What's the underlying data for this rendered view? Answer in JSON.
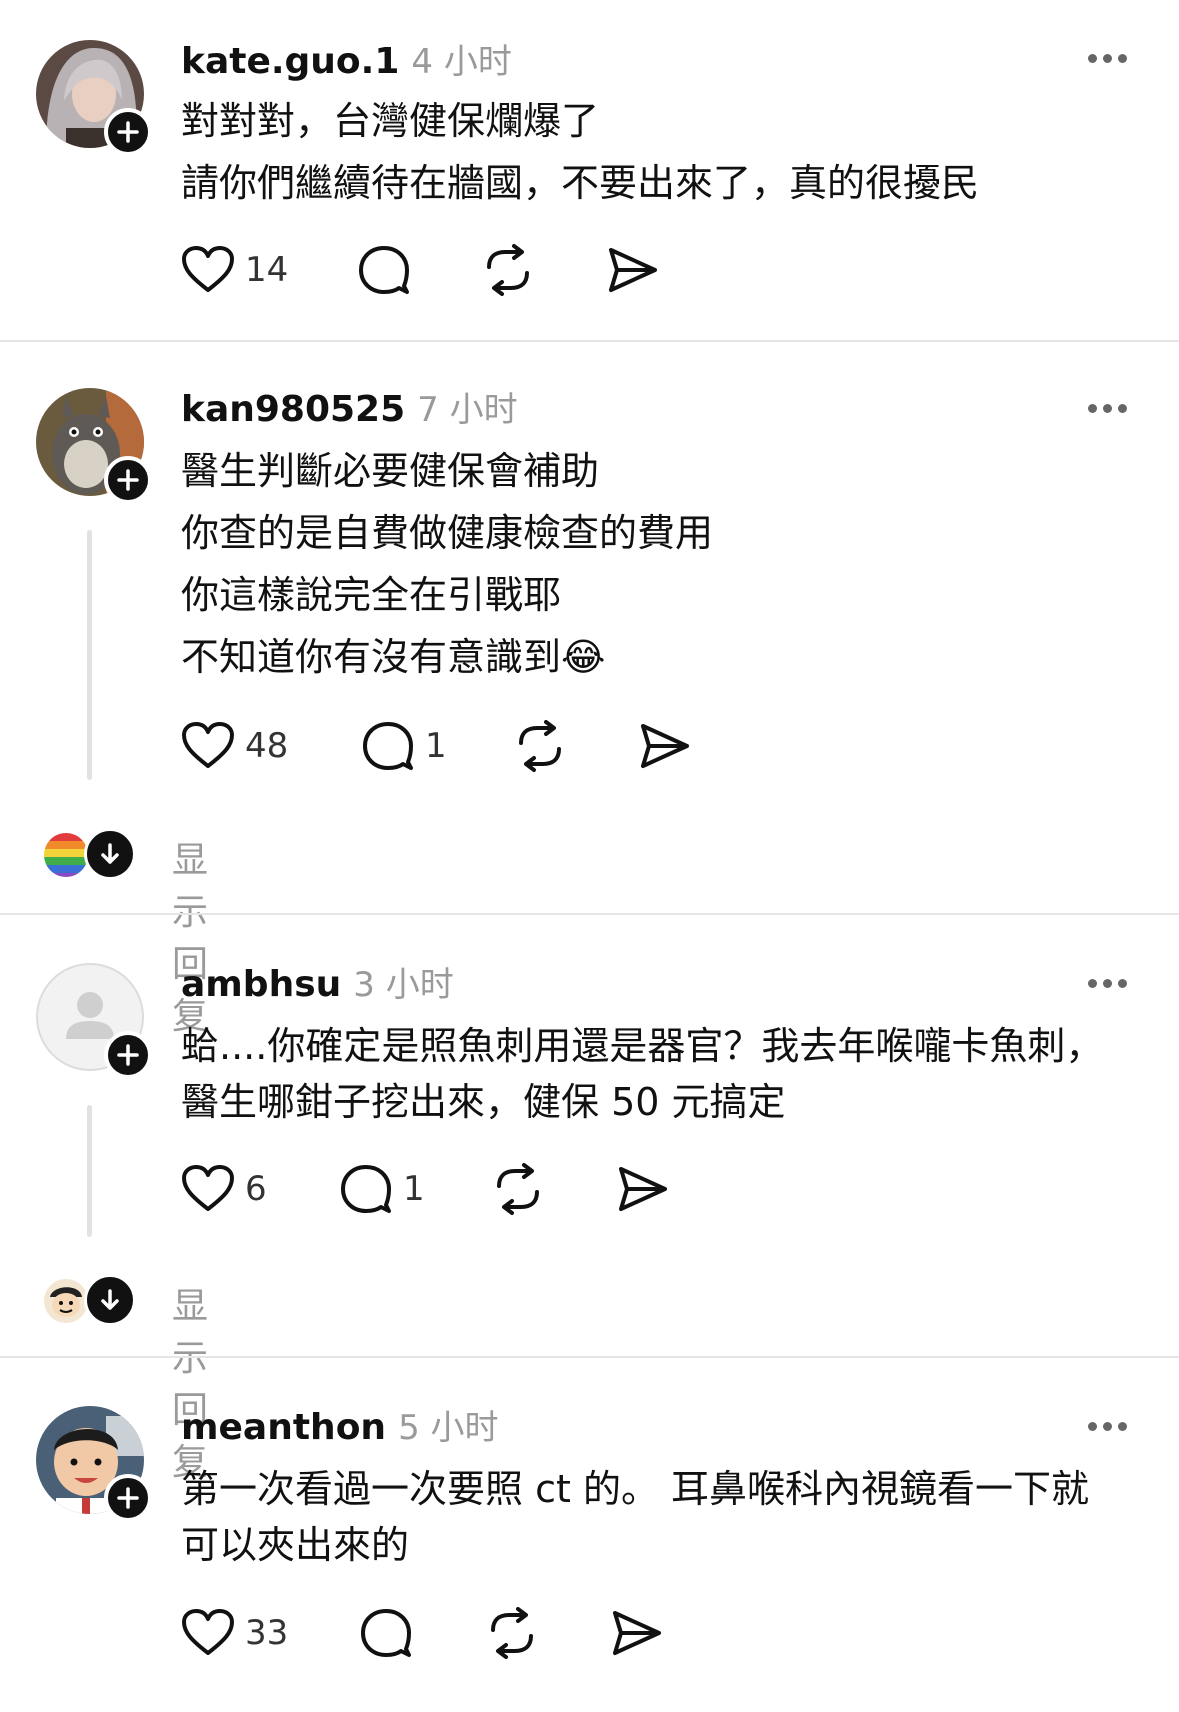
{
  "posts": [
    {
      "username": "kate.guo.1",
      "time": "4 小时",
      "lines": [
        "對對對，台灣健保爛爆了",
        "請你們繼續待在牆國，不要出來了，真的很擾民"
      ],
      "likes": "14",
      "comments": "",
      "avatar_icon": "profile-photo-woman"
    },
    {
      "username": "kan980525",
      "time": "7 小时",
      "lines": [
        "醫生判斷必要健保會補助",
        "你查的是自費做健康檢查的費用",
        "你這樣說完全在引戰耶",
        "不知道你有沒有意識到😂"
      ],
      "likes": "48",
      "comments": "1",
      "avatar_icon": "profile-photo-totoro",
      "show_replies": "显示回复"
    },
    {
      "username": "ambhsu",
      "time": "3 小时",
      "lines": [
        "蛤....你確定是照魚刺用還是器官？我去年喉嚨卡魚刺，",
        "醫生哪鉗子挖出來，健保 50 元搞定"
      ],
      "likes": "6",
      "comments": "1",
      "avatar_icon": "default-user-icon",
      "show_replies": "显示回复"
    },
    {
      "username": "meanthon",
      "time": "5 小时",
      "lines": [
        "第一次看過一次要照 ct 的。 耳鼻喉科內視鏡看一下就",
        "可以夾出來的"
      ],
      "likes": "33",
      "comments": "",
      "avatar_icon": "profile-photo-child"
    }
  ],
  "colors": {
    "text": "#111111",
    "muted": "#9a9a9a",
    "divider": "#e6e6e6"
  }
}
